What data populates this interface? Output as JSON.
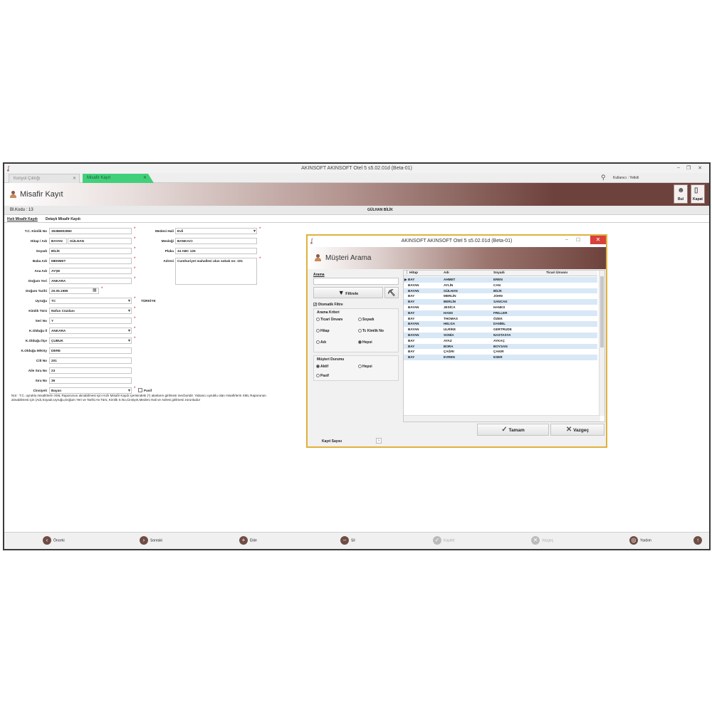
{
  "window": {
    "title": "AKINSOFT AKINSOFT Otel 5 s5.02.01d (Beta-01)",
    "tabs": [
      {
        "label": "Konyol Çıktığı",
        "active": false
      },
      {
        "label": "Misafir Kayıt",
        "active": true
      }
    ],
    "user_label": "Kullanıcı : Yetkili"
  },
  "header": {
    "title": "Misafir Kayıt",
    "buttons": [
      {
        "label": "Bul",
        "icon": "person-search-icon"
      },
      {
        "label": "Kapat",
        "icon": "close-door-icon"
      }
    ]
  },
  "info": {
    "bl_kodu": "Bl.Kodu :  13",
    "guest_name": "GÜLHAN BİLİK"
  },
  "subtabs": [
    "Hızlı Misafir Kaydı",
    "Detaylı Misafir Kaydı"
  ],
  "form": {
    "tc_label": "T.C. Kimlik No",
    "tc": "35386902860",
    "hitap_label": "Hitap / Adı",
    "hitap": "BAYAN",
    "adi": "GÜLHAN",
    "soyadi_label": "Soyadı",
    "soyadi": "BİLİK",
    "baba_label": "Baba Adı",
    "baba": "MEHMET",
    "ana_label": "Ana Adı",
    "ana": "AYŞE",
    "dogumyeri_label": "Doğum Yeri",
    "dogumyeri": "ANKARA",
    "dogumtarihi_label": "Doğum Tarihi",
    "dogumtarihi": "20.05.1985",
    "uyruk_label": "Uyruğu",
    "uyruk": "TC",
    "uyruk_text": "TÜRKİYE",
    "kimlikturu_label": "Kimlik Türü",
    "kimlikturu": "Nüfus Cüzdanı",
    "serino_label": "Seri No",
    "serino": "Y",
    "il_label": "K.Olduğu İl",
    "il": "ANKARA",
    "ilce_label": "K.Olduğu İlçe",
    "ilce": "ÇUBUK",
    "koy_label": "K.Olduğu M/Köy",
    "koy": "DERE",
    "cilt_label": "Cilt No",
    "cilt": "201",
    "aile_label": "Aile Sıra No",
    "aile": "23",
    "sira_label": "Sıra No",
    "sira": "36",
    "cinsiyet_label": "Cinsiyeti",
    "cinsiyet": "Bayan",
    "pasif_label": "Pasif",
    "medeni_label": "Medeni Hali",
    "medeni": "Evli",
    "meslek_label": "Mesleği",
    "meslek": "BANKACI",
    "plaka_label": "Plaka",
    "plaka": "34 ABC 125",
    "adres_label": "Adresi",
    "adres": "Cumhuriyet mahallesi ulus sokak no: 101",
    "note": "Not : T.C. uyruklu misafirlerin XML Raporunun alınabilmesi için Hızlı Misafir Kaydı içerisindeki (*) alanların girilmesi mecburidir. Yabancı uyruklu olan misafirlerin XML Raporunun alınabilmesi için (Adı,Soyadı,Uyruğu,Doğum Yeri ve Tarihi,Hv.Türü, Kimlik S.No,Cinsiyet,Medeni Hali ve Adresi girilmesi zorunludur"
  },
  "dialog": {
    "title": "AKINSOFT AKINSOFT Otel 5 s5.02.01d (Beta-01)",
    "header": "Müşteri Arama",
    "search_label": "Arama",
    "search_value": "",
    "filter_button": "Filtrele",
    "auto_filter": "Otomatik Filtre",
    "criteria_title": "Arama Kriteri",
    "criteria": [
      {
        "label": "Ticari Ünvanı",
        "checked": false
      },
      {
        "label": "Soyadı",
        "checked": false
      },
      {
        "label": "Hitap",
        "checked": false
      },
      {
        "label": "Tc Kimlik No",
        "checked": false
      },
      {
        "label": "Adı",
        "checked": false
      },
      {
        "label": "Hepsi",
        "checked": true
      }
    ],
    "status_title": "Müşteri Durumu",
    "status": [
      {
        "label": "Aktif",
        "checked": true
      },
      {
        "label": "Hepsi",
        "checked": false
      },
      {
        "label": "Pasif",
        "checked": false
      }
    ],
    "record_count_label": "Kayıt Sayısı",
    "columns": [
      "Hitap",
      "Adı",
      "Soyadı",
      "Ticari Ünvanı"
    ],
    "rows": [
      [
        "BAY",
        "AHMET",
        "EREN",
        ""
      ],
      [
        "BAYAN",
        "AYLİN",
        "CAN",
        ""
      ],
      [
        "BAYAN",
        "GÜLHAN",
        "BİLİK",
        ""
      ],
      [
        "BAY",
        "MERLİN",
        "JOHN",
        ""
      ],
      [
        "BAY",
        "BERLİN",
        "SANCAK",
        ""
      ],
      [
        "BAYAN",
        "JESİCA",
        "HANKS",
        ""
      ],
      [
        "BAY",
        "HANS",
        "FRILLER",
        ""
      ],
      [
        "BAY",
        "THOMAS",
        "ÖZEK",
        ""
      ],
      [
        "BAYAN",
        "HELGA",
        "DANİEL",
        ""
      ],
      [
        "BAYAN",
        "ULRİKE",
        "GERTRUDE",
        ""
      ],
      [
        "BAYAN",
        "SONİA",
        "NASTASYA",
        ""
      ],
      [
        "BAY",
        "AYAZ",
        "AYKAÇ",
        ""
      ],
      [
        "BAY",
        "BORA",
        "BOYSAN",
        ""
      ],
      [
        "BAY",
        "ÇAĞRI",
        "ÇAKIR",
        ""
      ],
      [
        "BAY",
        "EVREN",
        "ESER",
        ""
      ]
    ],
    "ok_button": "Tamam",
    "cancel_button": "Vazgeç"
  },
  "bottom": {
    "prev": "Önceki",
    "next": "Sonraki",
    "add": "Ekle",
    "delete": "Sil",
    "save": "Kaydet",
    "cancel": "Vazgeç",
    "help": "Yardım"
  }
}
